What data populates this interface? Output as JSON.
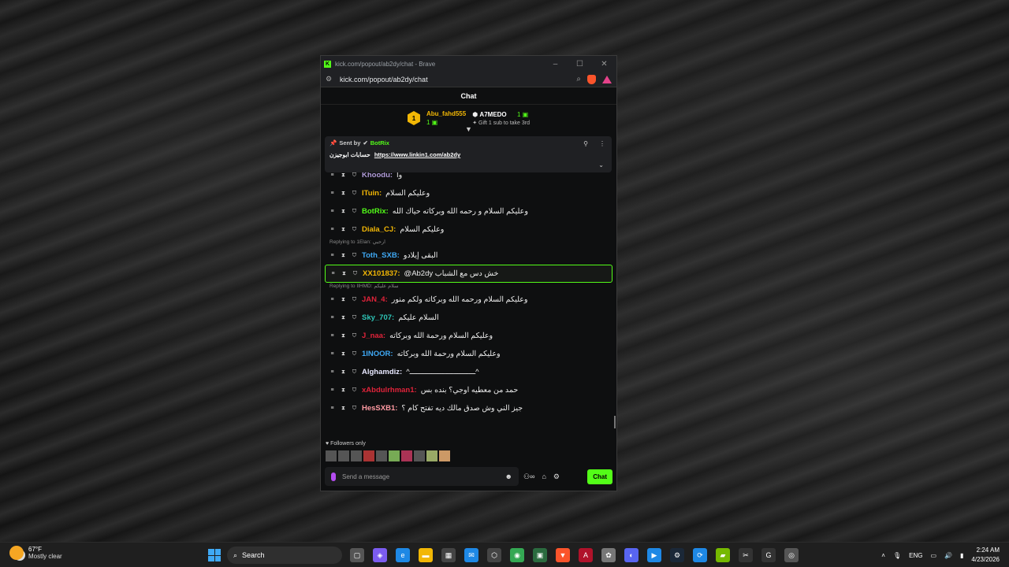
{
  "browser": {
    "title": "kick.com/popout/ab2dy/chat - Brave",
    "url": "kick.com/popout/ab2dy/chat"
  },
  "chat": {
    "header": "Chat",
    "leaderboard": {
      "first": {
        "rank": "1",
        "name": "Abu_fahd555",
        "count": "1"
      },
      "second": {
        "name": "A7MEDO",
        "count": "1",
        "gift_text": "Gift 1 sub to take 3rd"
      }
    },
    "pinned": {
      "sent_by": "Sent by",
      "bot": "BotRix",
      "text": "حسابات ابوجيزن",
      "link": "https://www.linkin1.com/ab2dy"
    },
    "messages": [
      {
        "user": "Khoodu:",
        "text": "وا",
        "color": "#b19cd9"
      },
      {
        "user": "ITuin:",
        "text": "وعليكم السلام",
        "color": "#f2b705"
      },
      {
        "user": "BotRix:",
        "text": "وعليكم السلام و رحمه الله وبركاته حياك الله",
        "color": "#53fc18"
      },
      {
        "user": "Diala_CJ:",
        "text": "وعليكم السلام",
        "color": "#f2b705"
      },
      {
        "reply": "Replying to 1Elan: ارحبي",
        "user": "Toth_SXB:",
        "text": "البقى إيلادو",
        "color": "#3fa9f5"
      },
      {
        "user": "XX101837:",
        "text": "@Ab2dy خش دس مع الشباب",
        "color": "#f2b705",
        "highlight": true
      },
      {
        "reply": "Replying to IIHMD: سلام عليكم",
        "user": "JAN_4:",
        "text": "وعليكم السلام ورحمه الله وبركاته ولكم منور",
        "color": "#e0233a"
      },
      {
        "user": "Sky_707:",
        "text": "السلام عليكم",
        "color": "#2ec4b6"
      },
      {
        "user": "J_naa:",
        "text": "وعليكم السلام ورحمة الله وبركاته",
        "color": "#e0233a"
      },
      {
        "user": "1INOOR:",
        "text": "وعليكم السلام ورحمة الله وبركاته",
        "color": "#3fa9f5"
      },
      {
        "user": "Alghamdiz:",
        "text": "^ــــــــــــــــــــــــــــــ^",
        "color": "#e8e8ff"
      },
      {
        "user": "xAbdulrhman1:",
        "text": "حمد من معطيه اوجي؟ بنده بس",
        "color": "#e0233a"
      },
      {
        "user": "HesSXB1:",
        "text": "جيز الني وش صدق مالك ديه تفتح كام ؟",
        "color": "#ff9aa2"
      }
    ],
    "followers_only": "Followers only",
    "placeholder": "Send a message",
    "send_label": "Chat"
  },
  "taskbar": {
    "temp": "67°F",
    "condition": "Mostly clear",
    "search": "Search",
    "lang": "ENG",
    "time": "2:24 AM",
    "date": "4/23/2026"
  }
}
